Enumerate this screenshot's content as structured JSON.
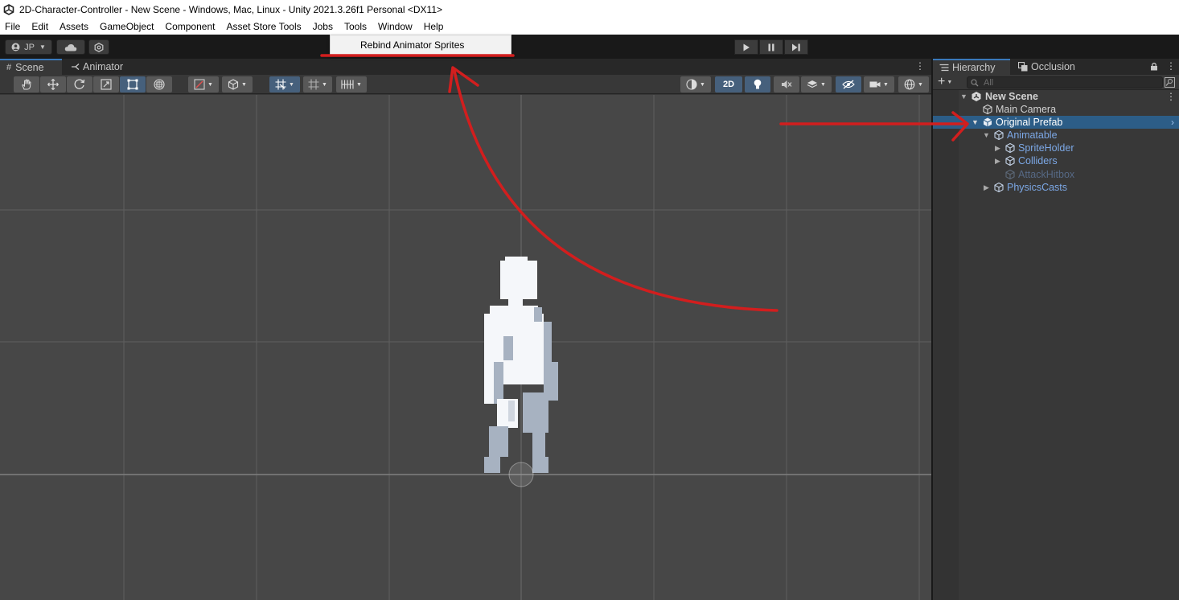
{
  "window": {
    "title": "2D-Character-Controller - New Scene - Windows, Mac, Linux - Unity 2021.3.26f1 Personal <DX11>"
  },
  "menubar": {
    "items": [
      "File",
      "Edit",
      "Assets",
      "GameObject",
      "Component",
      "Asset Store Tools",
      "Jobs",
      "Tools",
      "Window",
      "Help"
    ]
  },
  "tools_menu": {
    "items": [
      "Rebind Animator Sprites"
    ]
  },
  "toolbar": {
    "account_label": "JP"
  },
  "scene_panel": {
    "tabs": [
      "Scene",
      "Animator"
    ],
    "mode_2d_label": "2D"
  },
  "hierarchy_panel": {
    "tabs": [
      "Hierarchy",
      "Occlusion"
    ],
    "search_placeholder": "All",
    "items": [
      {
        "label": "New Scene",
        "depth": 0,
        "expanded": true,
        "type": "scene"
      },
      {
        "label": "Main Camera",
        "depth": 1,
        "type": "gameobject"
      },
      {
        "label": "Original Prefab",
        "depth": 1,
        "expanded": true,
        "selected": true,
        "type": "prefab"
      },
      {
        "label": "Animatable",
        "depth": 2,
        "expanded": true,
        "type": "prefab"
      },
      {
        "label": "SpriteHolder",
        "depth": 3,
        "expanded": false,
        "type": "prefab"
      },
      {
        "label": "Colliders",
        "depth": 3,
        "expanded": false,
        "type": "prefab"
      },
      {
        "label": "AttackHitbox",
        "depth": 3,
        "type": "prefab-inactive"
      },
      {
        "label": "PhysicsCasts",
        "depth": 2,
        "expanded": false,
        "type": "prefab"
      }
    ]
  },
  "colors": {
    "editor_bg": "#383838",
    "scene_bg": "#474747",
    "selection": "#2c5d87",
    "prefab_text": "#7ca8e6",
    "annotation_red": "#d21e1e"
  }
}
